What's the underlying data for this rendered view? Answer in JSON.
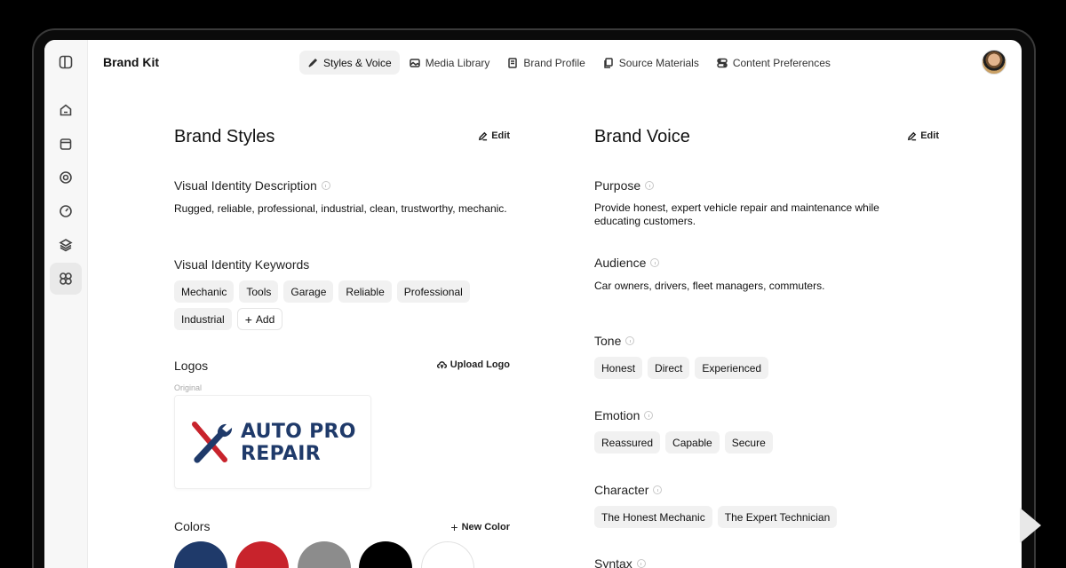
{
  "header": {
    "app_title": "Brand Kit",
    "tabs": [
      {
        "label": "Styles & Voice",
        "icon": "brush-icon",
        "active": true
      },
      {
        "label": "Media Library",
        "icon": "image-icon"
      },
      {
        "label": "Brand Profile",
        "icon": "document-icon"
      },
      {
        "label": "Source Materials",
        "icon": "files-icon"
      },
      {
        "label": "Content Preferences",
        "icon": "toggles-icon"
      }
    ]
  },
  "sidebar": {
    "items": [
      {
        "icon": "panel-toggle-icon"
      },
      {
        "icon": "home-icon"
      },
      {
        "icon": "calendar-icon"
      },
      {
        "icon": "coin-icon"
      },
      {
        "icon": "gauge-icon"
      },
      {
        "icon": "layers-icon"
      },
      {
        "icon": "brand-kit-icon",
        "active": true
      }
    ]
  },
  "brand_styles": {
    "title": "Brand Styles",
    "edit_label": "Edit",
    "visual_identity_description": {
      "label": "Visual Identity Description",
      "text": "Rugged, reliable, professional, industrial, clean, trustworthy, mechanic."
    },
    "visual_identity_keywords": {
      "label": "Visual Identity Keywords",
      "keywords": [
        "Mechanic",
        "Tools",
        "Garage",
        "Reliable",
        "Professional",
        "Industrial"
      ],
      "add_label": "Add"
    },
    "logos": {
      "label": "Logos",
      "upload_label": "Upload Logo",
      "original_label": "Original",
      "logo_line1": "AUTO PRO",
      "logo_line2": "REPAIR",
      "logo_colors": {
        "navy": "#1f3a6a",
        "red": "#c8232c"
      }
    },
    "colors": {
      "label": "Colors",
      "new_color_label": "New Color",
      "swatches": [
        "#1f3a6a",
        "#c8232c",
        "#8c8c8c",
        "#000000",
        "#ffffff"
      ]
    }
  },
  "brand_voice": {
    "title": "Brand Voice",
    "edit_label": "Edit",
    "purpose": {
      "label": "Purpose",
      "text": "Provide honest, expert vehicle repair and maintenance while educating customers."
    },
    "audience": {
      "label": "Audience",
      "text": "Car owners, drivers, fleet managers, commuters."
    },
    "tone": {
      "label": "Tone",
      "chips": [
        "Honest",
        "Direct",
        "Experienced"
      ]
    },
    "emotion": {
      "label": "Emotion",
      "chips": [
        "Reassured",
        "Capable",
        "Secure"
      ]
    },
    "character": {
      "label": "Character",
      "chips": [
        "The Honest Mechanic",
        "The Expert Technician"
      ]
    },
    "syntax": {
      "label": "Syntax"
    }
  }
}
